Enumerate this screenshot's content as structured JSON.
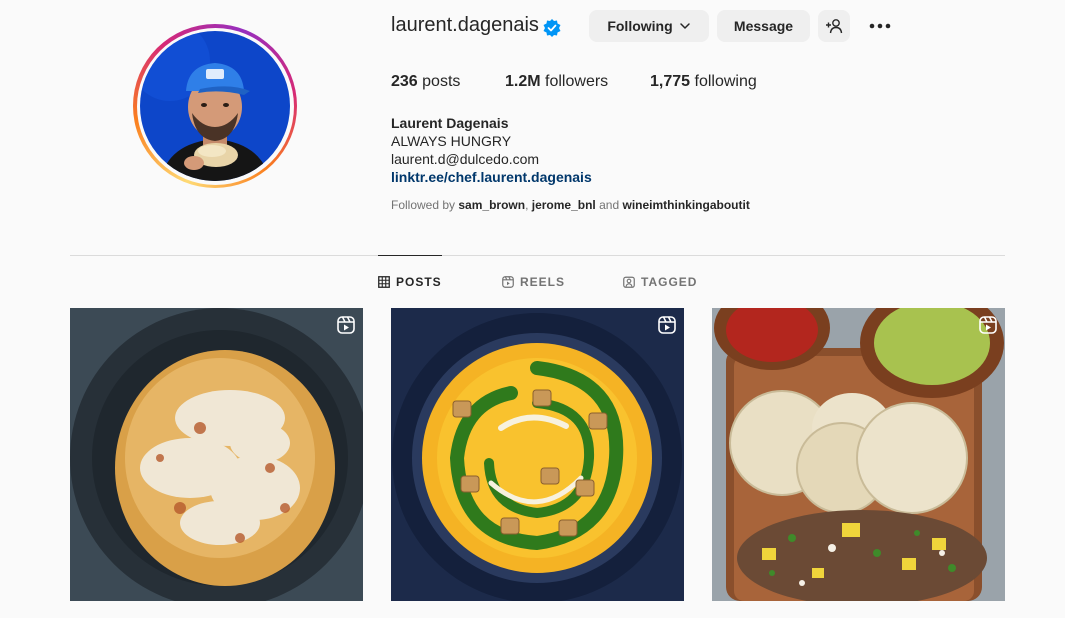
{
  "profile": {
    "username": "laurent.dagenais",
    "verified": true,
    "buttons": {
      "following": "Following",
      "message": "Message"
    },
    "stats": {
      "posts_count": "236",
      "posts_label": "posts",
      "followers_count": "1.2M",
      "followers_label": "followers",
      "following_count": "1,775",
      "following_label": "following"
    },
    "bio": {
      "full_name": "Laurent Dagenais",
      "line1": "ALWAYS HUNGRY",
      "email": "laurent.d@dulcedo.com",
      "link": "linktr.ee/chef.laurent.dagenais"
    },
    "followed_by": {
      "prefix": "Followed by",
      "user1": "sam_brown",
      "separator": ",",
      "user2": "jerome_bnl",
      "conjunction": "and",
      "user3": "wineimthinkingaboutit"
    }
  },
  "tabs": [
    {
      "label": "POSTS",
      "icon": "grid-icon",
      "active": true
    },
    {
      "label": "REELS",
      "icon": "reels-icon",
      "active": false
    },
    {
      "label": "TAGGED",
      "icon": "tagged-icon",
      "active": false
    }
  ],
  "posts": [
    {
      "subject": "pasta with grated cheese",
      "icon": "reel-badge-icon"
    },
    {
      "subject": "squash soup with herb oil and croutons",
      "icon": "reel-badge-icon"
    },
    {
      "subject": "tacos with tortillas and salsas",
      "icon": "reel-badge-icon"
    }
  ],
  "colors": {
    "background": "#fafafa",
    "text": "#262626",
    "secondary_text": "#737373",
    "link": "#00376b",
    "verified_badge": "#0095f6",
    "button_bg": "#efefef",
    "divider": "#dbdbdb"
  }
}
